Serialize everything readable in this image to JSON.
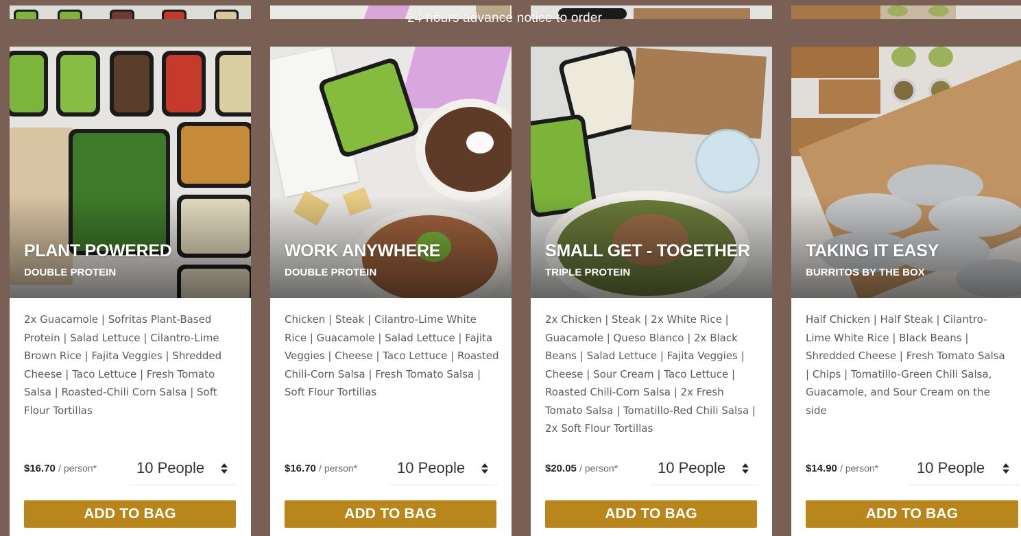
{
  "notice": "24 hours advance notice to order",
  "colors": {
    "background": "#7a5f55",
    "accent": "#b8861b"
  },
  "cards": [
    {
      "title": "PLANT POWERED",
      "subtitle": "DOUBLE PROTEIN",
      "description": "2x Guacamole | Sofritas Plant-Based Protein | Salad Lettuce | Cilantro-Lime Brown Rice | Fajita Veggies | Shredded Cheese | Taco Lettuce | Fresh Tomato Salsa | Roasted-Chili Corn Salsa | Soft Flour Tortillas",
      "price": "$16.70",
      "price_unit": "/ person*",
      "people": "10 People",
      "button": "ADD TO BAG"
    },
    {
      "title": "WORK ANYWHERE",
      "subtitle": "DOUBLE PROTEIN",
      "description": "Chicken | Steak | Cilantro-Lime White Rice | Guacamole | Salad Lettuce | Fajita Veggies | Cheese | Taco Lettuce | Roasted Chili-Corn Salsa | Fresh Tomato Salsa | Soft Flour Tortillas",
      "price": "$16.70",
      "price_unit": "/ person*",
      "people": "10 People",
      "button": "ADD TO BAG"
    },
    {
      "title": "SMALL GET - TOGETHER",
      "subtitle": "TRIPLE PROTEIN",
      "description": "2x Chicken | Steak | 2x White Rice | Guacamole | Queso Blanco | 2x Black Beans | Salad Lettuce | Fajita Veggies | Cheese | Sour Cream | Taco Lettuce | Roasted Chili-Corn Salsa | 2x Fresh Tomato Salsa | Tomatillo-Red Chili Salsa | 2x Soft Flour Tortillas",
      "price": "$20.05",
      "price_unit": "/ person*",
      "people": "10 People",
      "button": "ADD TO BAG"
    },
    {
      "title": "TAKING IT EASY",
      "subtitle": "BURRITOS BY THE BOX",
      "description": "Half Chicken | Half Steak | Cilantro-Lime White Rice | Black Beans | Shredded Cheese | Fresh Tomato Salsa | Chips | Tomatillo-Green Chili Salsa, Guacamole, and Sour Cream on the side",
      "price": "$14.90",
      "price_unit": "/ person*",
      "people": "10 People",
      "button": "ADD TO BAG"
    }
  ]
}
